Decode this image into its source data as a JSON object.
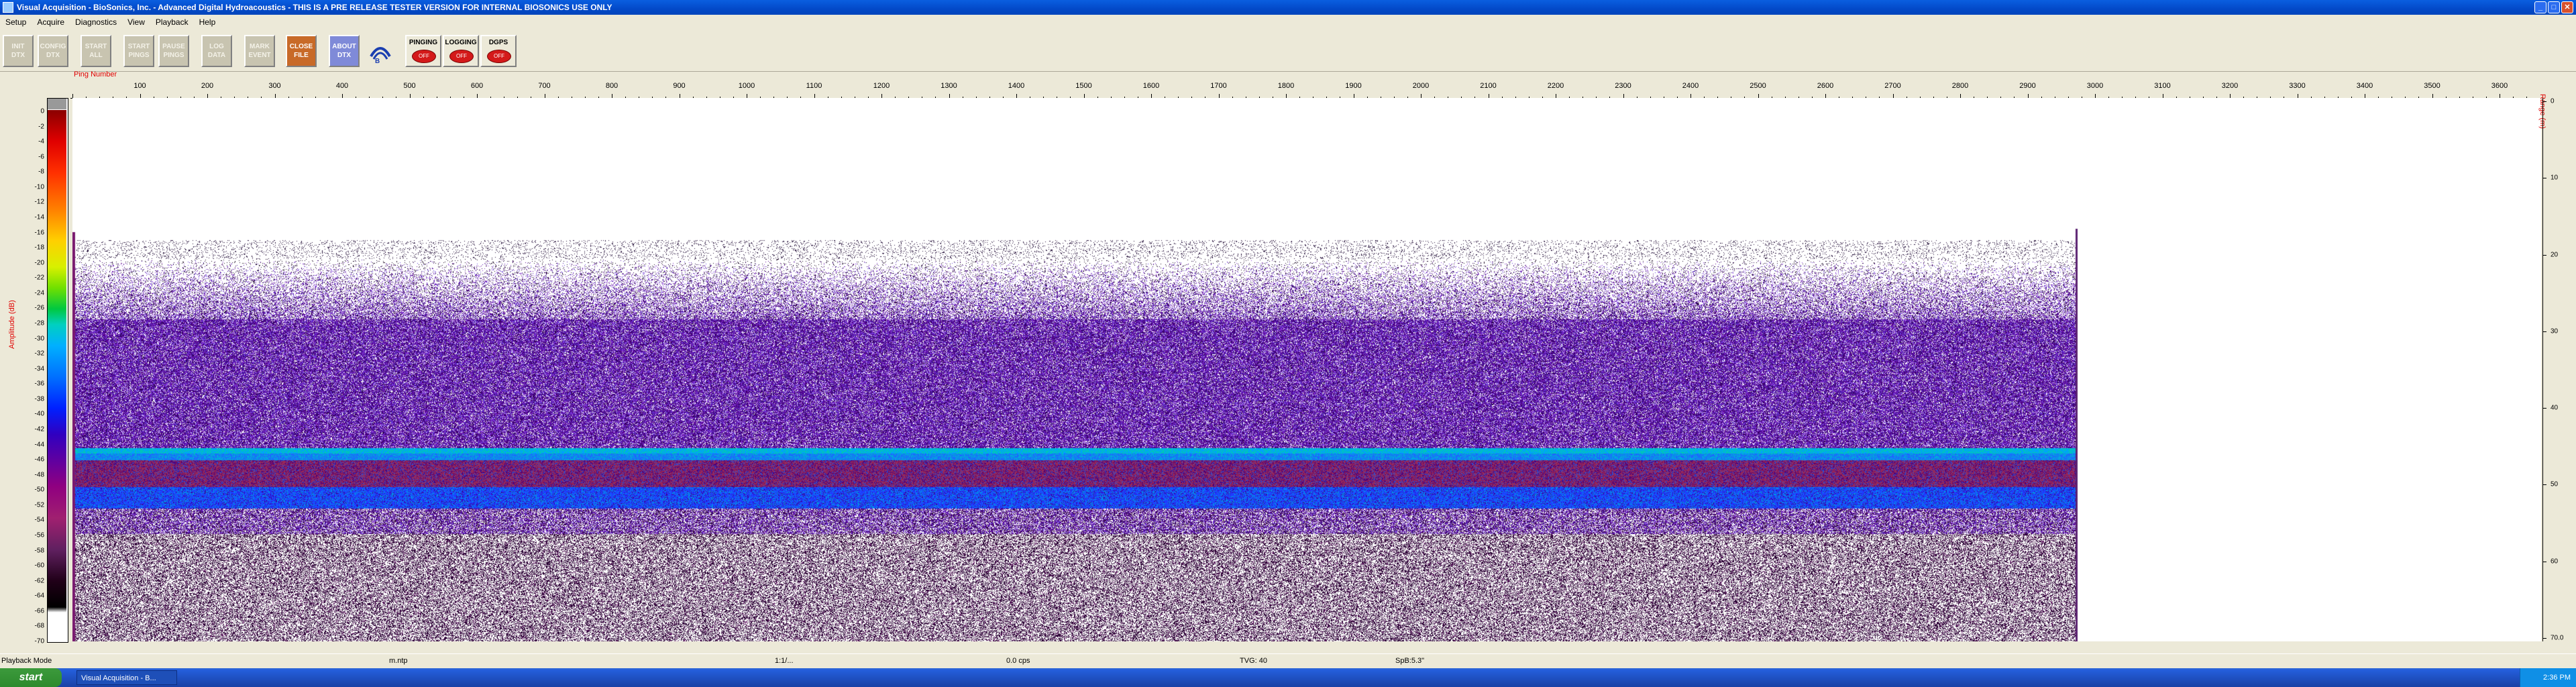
{
  "window": {
    "title": "Visual Acquisition - BioSonics, Inc. - Advanced Digital Hydroacoustics - THIS IS A PRE RELEASE TESTER VERSION FOR INTERNAL BIOSONICS USE ONLY"
  },
  "menu": [
    "Setup",
    "Acquire",
    "Diagnostics",
    "View",
    "Playback",
    "Help"
  ],
  "toolbar": {
    "buttons": [
      "INIT\nDTX",
      "CONFIG\nDTX",
      "START\nALL",
      "START\nPINGS",
      "PAUSE\nPINGS",
      "LOG\nDATA",
      "MARK\nEVENT",
      "CLOSE\nFILE",
      "ABOUT\nDTX"
    ],
    "indicators": [
      {
        "label": "PINGING",
        "state": "OFF"
      },
      {
        "label": "LOGGING",
        "state": "OFF"
      },
      {
        "label": "DGPS",
        "state": "OFF"
      }
    ]
  },
  "echogram": {
    "x_label": "Ping Number",
    "x_ticks": [
      "100",
      "200",
      "300",
      "400",
      "500",
      "600",
      "700",
      "800",
      "900",
      "1000",
      "1100",
      "1200",
      "1300",
      "1400",
      "1500",
      "1600",
      "1700",
      "1800",
      "1900",
      "2000",
      "2100",
      "2200",
      "2300",
      "2400",
      "2500",
      "2600",
      "2700",
      "2800",
      "2900",
      "3000",
      "3100",
      "3200",
      "3300",
      "3400",
      "3500",
      "3600"
    ],
    "left_axis_label": "Amplitude (dB)",
    "left_ticks": [
      "0",
      "-2",
      "-4",
      "-6",
      "-8",
      "-10",
      "-12",
      "-14",
      "-16",
      "-18",
      "-20",
      "-22",
      "-24",
      "-26",
      "-28",
      "-30",
      "-32",
      "-34",
      "-36",
      "-38",
      "-40",
      "-42",
      "-44",
      "-46",
      "-48",
      "-50",
      "-52",
      "-54",
      "-56",
      "-58",
      "-60",
      "-62",
      "-64",
      "-66",
      "-68",
      "-70"
    ],
    "right_axis_label": "Range (m)",
    "right_ticks": [
      "0",
      "10",
      "20",
      "30",
      "40",
      "50",
      "60",
      "70.0"
    ],
    "data_end_ping": 2970
  },
  "status": {
    "mode": "Playback Mode",
    "units": "m.ntp",
    "field3": "1:1/...",
    "field4": "0.0 cps",
    "tvg": "TVG: 40",
    "sp": "SpB:5.3\""
  },
  "taskbar": {
    "start": "start",
    "task": "Visual Acquisition - B...",
    "clock": "2:36 PM"
  },
  "colors": {
    "title_blue": "#0349c8",
    "label_red": "#e00000"
  }
}
